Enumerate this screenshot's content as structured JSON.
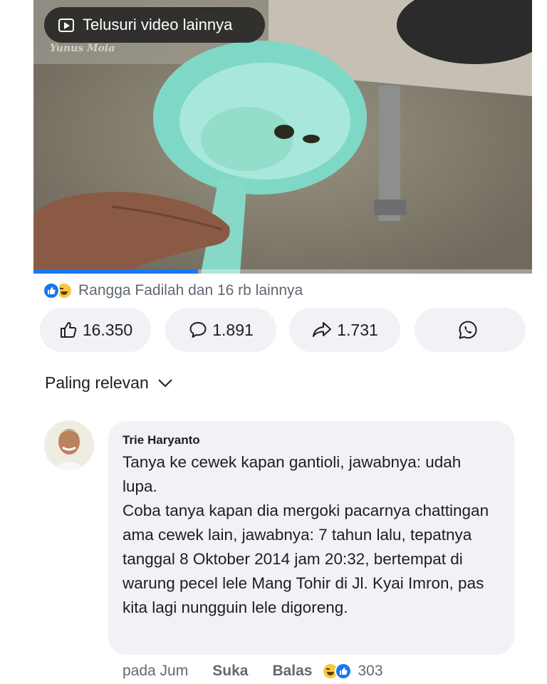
{
  "video": {
    "explore_label": "Telusuri video lainnya",
    "watermark": "Yunus Moia",
    "progress": 0.33
  },
  "reactions": {
    "summary": "Rangga Fadilah dan 16 rb lainnya"
  },
  "actions": {
    "like_count": "16.350",
    "comment_count": "1.891",
    "share_count": "1.731"
  },
  "comments_sort": {
    "label": "Paling relevan"
  },
  "comment": {
    "author": "Trie Haryanto",
    "paragraph1": "Tanya ke cewek kapan gantioli, jawabnya: udah lupa.",
    "paragraph2": "Coba tanya kapan dia mergoki pacarnya chattingan ama cewek lain, jawabnya: 7 tahun lalu, tepatnya tanggal 8 Oktober 2014 jam 20:32, bertempat di warung pecel lele Mang Tohir di Jl. Kyai Imron, pas kita lagi nungguin lele digoreng.",
    "time": "pada Jum",
    "like_label": "Suka",
    "reply_label": "Balas",
    "reaction_count": "303"
  },
  "colors": {
    "accent": "#1877f2",
    "pill_bg": "#f0f2f5",
    "muted_text": "#65676b"
  }
}
